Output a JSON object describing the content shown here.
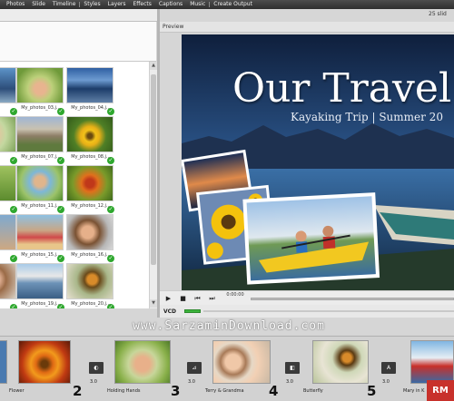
{
  "menu": [
    "Photos",
    "Slide",
    "Timeline",
    "Styles",
    "Layers",
    "Effects",
    "Captions",
    "Music",
    "Create Output"
  ],
  "preview": {
    "header": "Preview",
    "slide_count": "25 slid",
    "title": "Our Travel",
    "subtitle": "Kayaking Trip | Summer 20",
    "time": "0:00:00",
    "output_format": "VCD"
  },
  "photos": [
    {
      "label": "",
      "thumb": "a"
    },
    {
      "label": "My_photos_03.j...",
      "thumb": "b"
    },
    {
      "label": "My_photos_04.j...",
      "thumb": "c"
    },
    {
      "label": "",
      "thumb": "d"
    },
    {
      "label": "My_photos_07.j...",
      "thumb": "e"
    },
    {
      "label": "My_photos_08.j...",
      "thumb": "f"
    },
    {
      "label": "",
      "thumb": "g"
    },
    {
      "label": "My_photos_11.j...",
      "thumb": "h"
    },
    {
      "label": "My_photos_12.j...",
      "thumb": "i"
    },
    {
      "label": "",
      "thumb": "j"
    },
    {
      "label": "My_photos_15.j...",
      "thumb": "k"
    },
    {
      "label": "My_photos_16.j...",
      "thumb": "l"
    },
    {
      "label": "",
      "thumb": "m"
    },
    {
      "label": "My_photos_19.j...",
      "thumb": "n"
    },
    {
      "label": "My_photos_20.j...",
      "thumb": "o"
    }
  ],
  "storyboard": {
    "slides": [
      {
        "number": "",
        "name": "Flower",
        "duration": "3.0"
      },
      {
        "number": "2",
        "name": "Flower",
        "duration": "3.0"
      },
      {
        "number": "3",
        "name": "Holding Hands",
        "duration": "3.0"
      },
      {
        "number": "4",
        "name": "Terry & Grandma",
        "duration": "3.0"
      },
      {
        "number": "5",
        "name": "Butterfly",
        "duration": "3.0"
      },
      {
        "number": "",
        "name": "Mary in K",
        "duration": "3.0"
      }
    ],
    "transitions": [
      {
        "duration": "3.0",
        "icon": "transition-icon"
      },
      {
        "duration": "3.0",
        "icon": "transition-icon"
      },
      {
        "duration": "3.0",
        "icon": "transition-icon"
      },
      {
        "duration": "3.0",
        "icon": "transition-icon"
      },
      {
        "duration": "3.0",
        "icon": "transition-icon"
      }
    ]
  },
  "watermark": "www.SarzaminDownload.com",
  "badge": "RM",
  "icons": {
    "play": "play-icon",
    "stop": "stop-icon",
    "prev": "previous-icon",
    "next": "next-icon",
    "check": "checkmark-icon",
    "scroll_up": "scroll-up-icon",
    "scroll_down": "scroll-down-icon"
  }
}
